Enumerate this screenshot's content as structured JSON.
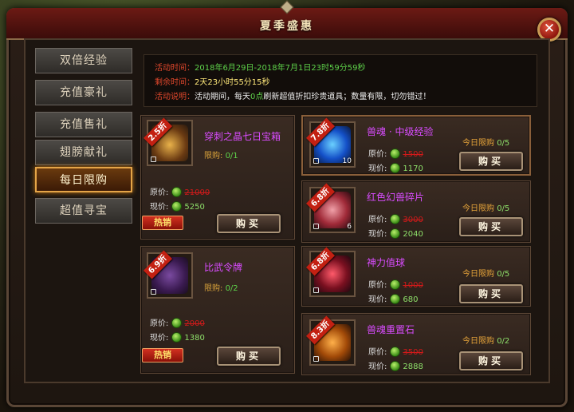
{
  "window": {
    "title": "夏季盛惠",
    "close_label": "✕"
  },
  "sidebar": {
    "items": [
      {
        "label": "双倍经验",
        "active": false
      },
      {
        "label": "充值豪礼",
        "active": false
      },
      {
        "label": "充值售礼",
        "active": false
      },
      {
        "label": "翅膀献礼",
        "active": false
      },
      {
        "label": "每日限购",
        "active": true
      },
      {
        "label": "超值寻宝",
        "active": false
      }
    ]
  },
  "info": {
    "time_label": "活动时间：",
    "time_value": "2018年6月29日-2018年7月1日23时59分59秒",
    "remain_label": "剩余时间：",
    "remain_value": "2天23小时55分15秒",
    "desc_label": "活动说明：",
    "desc_pre": "活动期间，每天",
    "desc_hl": "0点",
    "desc_post": "刷新超值折扣珍贵道具；数量有限，切勿错过！"
  },
  "labels": {
    "orig_price": "原价:",
    "cur_price": "现价:",
    "limit_key": "限购:",
    "today_key": "今日限购",
    "buy": "购买",
    "hot": "热销"
  },
  "left_items": [
    {
      "name": "穿刺之晶七日宝箱",
      "discount": "2.5折",
      "limit": "0/1",
      "orig": "21000",
      "now": "5250",
      "hot": true
    },
    {
      "name": "比武令牌",
      "discount": "6.9折",
      "limit": "0/2",
      "orig": "2000",
      "now": "1380",
      "hot": true
    }
  ],
  "right_items": [
    {
      "name": "兽魂 · 中级经验",
      "discount": "7.8折",
      "qty": "10",
      "orig": "1500",
      "now": "1170",
      "today": "0/5"
    },
    {
      "name": "红色幻兽碎片",
      "discount": "6.8折",
      "qty": "6",
      "orig": "3000",
      "now": "2040",
      "today": "0/5"
    },
    {
      "name": "神力值球",
      "discount": "6.8折",
      "qty": "",
      "orig": "1000",
      "now": "680",
      "today": "0/5"
    },
    {
      "name": "兽魂重置石",
      "discount": "8.3折",
      "qty": "",
      "orig": "3500",
      "now": "2888",
      "today": "0/2"
    }
  ],
  "colors": {
    "accent": "#e5a548",
    "title_bar": "#6c1a14",
    "price_new": "#8ee06a",
    "price_old": "#d01a1a"
  }
}
